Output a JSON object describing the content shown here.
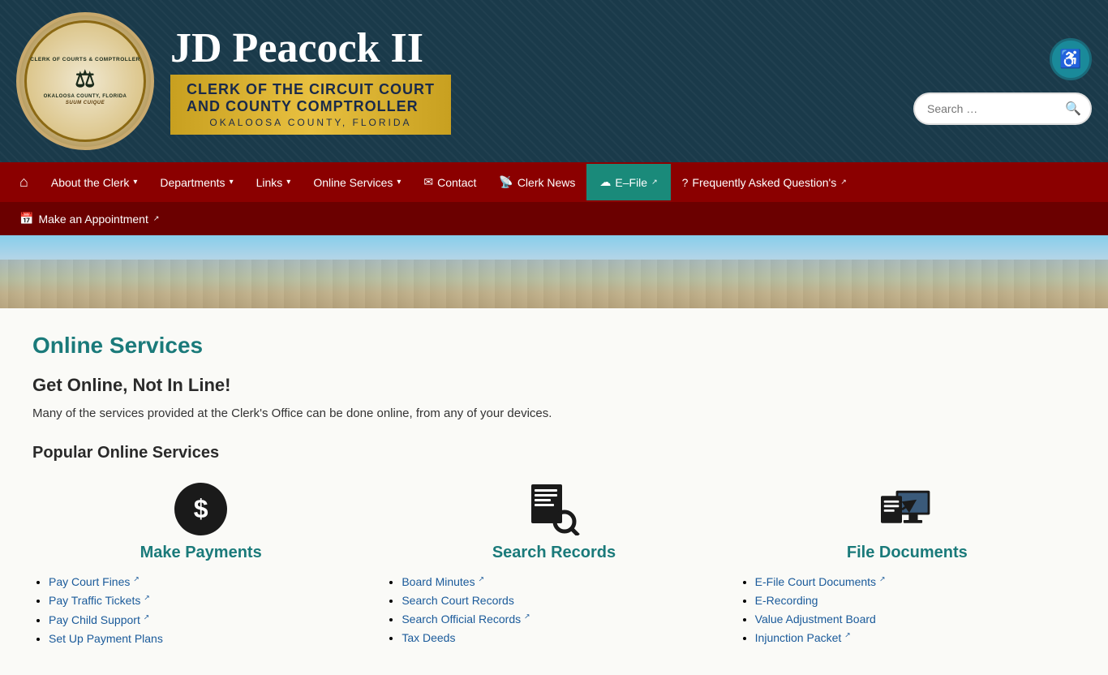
{
  "header": {
    "site_name": "JD Peacock II",
    "subtitle_line1": "Clerk of the Circuit Court",
    "subtitle_line2": "and County Comptroller",
    "location": "Okaloosa County, Florida",
    "search_placeholder": "Search …",
    "accessibility_icon": "♿"
  },
  "nav": {
    "home_icon": "⌂",
    "items": [
      {
        "label": "About the Clerk",
        "dropdown": true
      },
      {
        "label": "Departments",
        "dropdown": true
      },
      {
        "label": "Links",
        "dropdown": true
      },
      {
        "label": "Online Services",
        "dropdown": true
      },
      {
        "label": "Contact",
        "icon": "✉"
      },
      {
        "label": "Clerk News",
        "icon": "📡"
      },
      {
        "label": "E–File",
        "external": true,
        "highlight": true
      },
      {
        "label": "Frequently Asked Question's",
        "external": true
      }
    ],
    "secondary": [
      {
        "label": "Make an Appointment",
        "external": true,
        "icon": "📅"
      }
    ]
  },
  "page": {
    "title": "Online Services",
    "heading": "Get Online, Not In Line!",
    "intro": "Many of the services provided at the Clerk's Office can be done online, from any of your devices.",
    "popular_heading": "Popular Online Services"
  },
  "services": [
    {
      "id": "make-payments",
      "title": "Make Payments",
      "icon_type": "dollar",
      "links": [
        {
          "label": "Pay Court Fines",
          "external": true
        },
        {
          "label": "Pay Traffic Tickets",
          "external": true
        },
        {
          "label": "Pay Child Support",
          "external": true
        },
        {
          "label": "Set Up Payment Plans",
          "external": false
        }
      ]
    },
    {
      "id": "search-records",
      "title": "Search Records",
      "icon_type": "search",
      "links": [
        {
          "label": "Board Minutes",
          "external": true
        },
        {
          "label": "Search Court Records",
          "external": false
        },
        {
          "label": "Search Official Records",
          "external": true
        },
        {
          "label": "Tax Deeds",
          "external": false
        }
      ]
    },
    {
      "id": "file-documents",
      "title": "File Documents",
      "icon_type": "file",
      "links": [
        {
          "label": "E-File Court Documents",
          "external": true
        },
        {
          "label": "E-Recording",
          "external": false
        },
        {
          "label": "Value Adjustment Board",
          "external": false
        },
        {
          "label": "Injunction Packet",
          "external": true
        }
      ]
    }
  ]
}
